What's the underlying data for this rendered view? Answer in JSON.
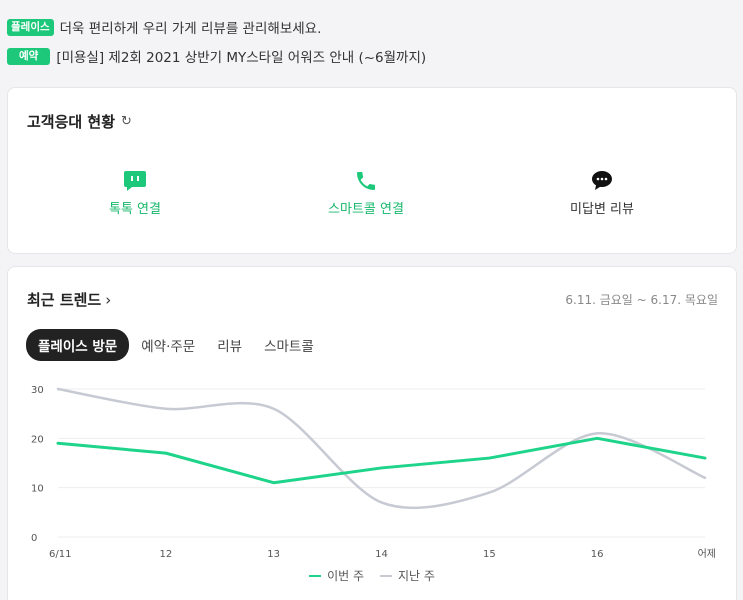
{
  "notices": [
    {
      "badge": "플레이스",
      "text": "더욱 편리하게 우리 가게 리뷰를 관리해보세요."
    },
    {
      "badge": "예약",
      "text": "[미용실] 제2회 2021 상반기 MY스타일 어워즈 안내 (~6월까지)"
    }
  ],
  "service": {
    "title": "고객응대 현황",
    "refresh_icon": "↻",
    "items": [
      {
        "label": "톡톡 연결",
        "icon": "chat-bubble-icon",
        "color": "#1ec87a"
      },
      {
        "label": "스마트콜 연결",
        "icon": "phone-icon",
        "color": "#1ec87a"
      },
      {
        "label": "미답변 리뷰",
        "icon": "speech-dots-icon",
        "color": "#111111"
      }
    ]
  },
  "trend": {
    "title": "최근 트렌드",
    "chevron": "›",
    "date_range": "6.11. 금요일 ~ 6.17. 목요일",
    "tabs": [
      "플레이스 방문",
      "예약·주문",
      "리뷰",
      "스마트콜"
    ],
    "active_tab": 0
  },
  "chart_data": {
    "type": "line",
    "categories": [
      "6/11",
      "12",
      "13",
      "14",
      "15",
      "16",
      "어제"
    ],
    "series": [
      {
        "name": "이번 주",
        "color": "#1ed48a",
        "values": [
          19,
          17,
          11,
          14,
          16,
          20,
          16
        ]
      },
      {
        "name": "지난 주",
        "color": "#c8cad3",
        "values": [
          30,
          26,
          26,
          7,
          9,
          21,
          12
        ]
      }
    ],
    "yticks": [
      0,
      10,
      20,
      30
    ],
    "ylim": [
      0,
      30
    ],
    "grid": true,
    "legend": "bottom-center"
  }
}
